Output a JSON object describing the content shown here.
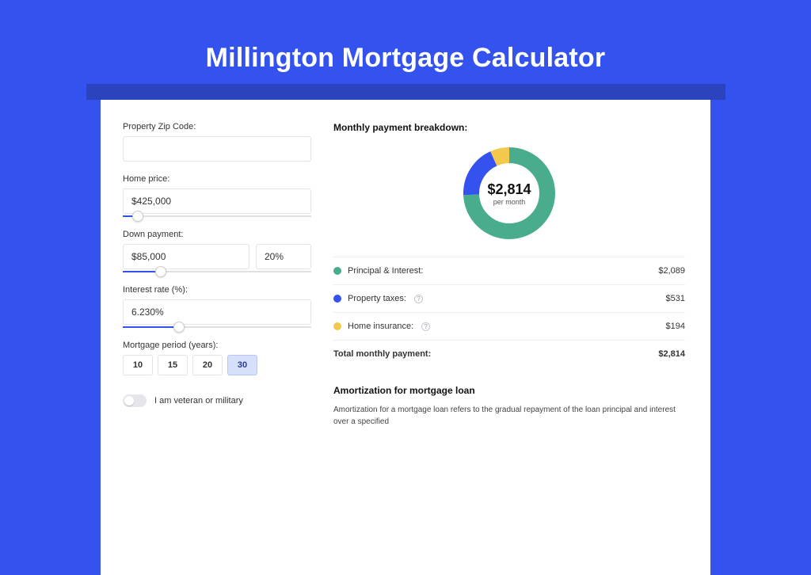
{
  "page": {
    "title": "Millington Mortgage Calculator"
  },
  "form": {
    "zip_label": "Property Zip Code:",
    "zip_value": "",
    "home_price_label": "Home price:",
    "home_price_value": "$425,000",
    "home_price_slider_pct": 8,
    "down_label": "Down payment:",
    "down_value": "$85,000",
    "down_pct_value": "20%",
    "down_slider_pct": 20,
    "rate_label": "Interest rate (%):",
    "rate_value": "6.230%",
    "rate_slider_pct": 30,
    "period_label": "Mortgage period (years):",
    "period_options": [
      "10",
      "15",
      "20",
      "30"
    ],
    "period_selected": "30",
    "veteran_label": "I am veteran or military",
    "veteran_on": false
  },
  "breakdown": {
    "title": "Monthly payment breakdown:",
    "center_value": "$2,814",
    "center_sub": "per month",
    "items": [
      {
        "label": "Principal & Interest:",
        "color": "#49ad8d",
        "value": "$2,089",
        "info": false
      },
      {
        "label": "Property taxes:",
        "color": "#3352ee",
        "value": "$531",
        "info": true
      },
      {
        "label": "Home insurance:",
        "color": "#f2c94c",
        "value": "$194",
        "info": true
      }
    ],
    "total_label": "Total monthly payment:",
    "total_value": "$2,814"
  },
  "amort": {
    "title": "Amortization for mortgage loan",
    "body": "Amortization for a mortgage loan refers to the gradual repayment of the loan principal and interest over a specified"
  },
  "chart_data": {
    "type": "pie",
    "title": "Monthly payment breakdown",
    "series": [
      {
        "name": "Principal & Interest",
        "value": 2089,
        "color": "#49ad8d"
      },
      {
        "name": "Property taxes",
        "value": 531,
        "color": "#3352ee"
      },
      {
        "name": "Home insurance",
        "value": 194,
        "color": "#f2c94c"
      }
    ],
    "total": 2814,
    "center_label": "$2,814 per month"
  }
}
